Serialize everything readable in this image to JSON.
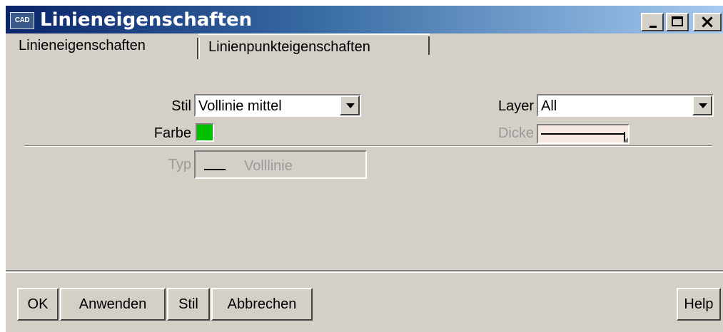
{
  "window": {
    "title": "Linieneigenschaften",
    "app_icon_text": "CAD",
    "controls": {
      "minimize": "minimize",
      "maximize": "maximize",
      "close": "×"
    }
  },
  "tabs": [
    {
      "label": "Linieneigenschaften",
      "active": true
    },
    {
      "label": "Linienpunkteigenschaften",
      "active": false
    }
  ],
  "form": {
    "stil_label": "Stil",
    "stil_value": "Vollinie mittel",
    "layer_label": "Layer",
    "layer_value": "All",
    "farbe_label": "Farbe",
    "farbe_color": "#00c000",
    "dicke_label": "Dicke",
    "typ_label": "Typ",
    "typ_value": "Volllinie"
  },
  "buttons": {
    "ok": "OK",
    "apply": "Anwenden",
    "style": "Stil",
    "cancel": "Abbrechen",
    "help": "Help"
  }
}
